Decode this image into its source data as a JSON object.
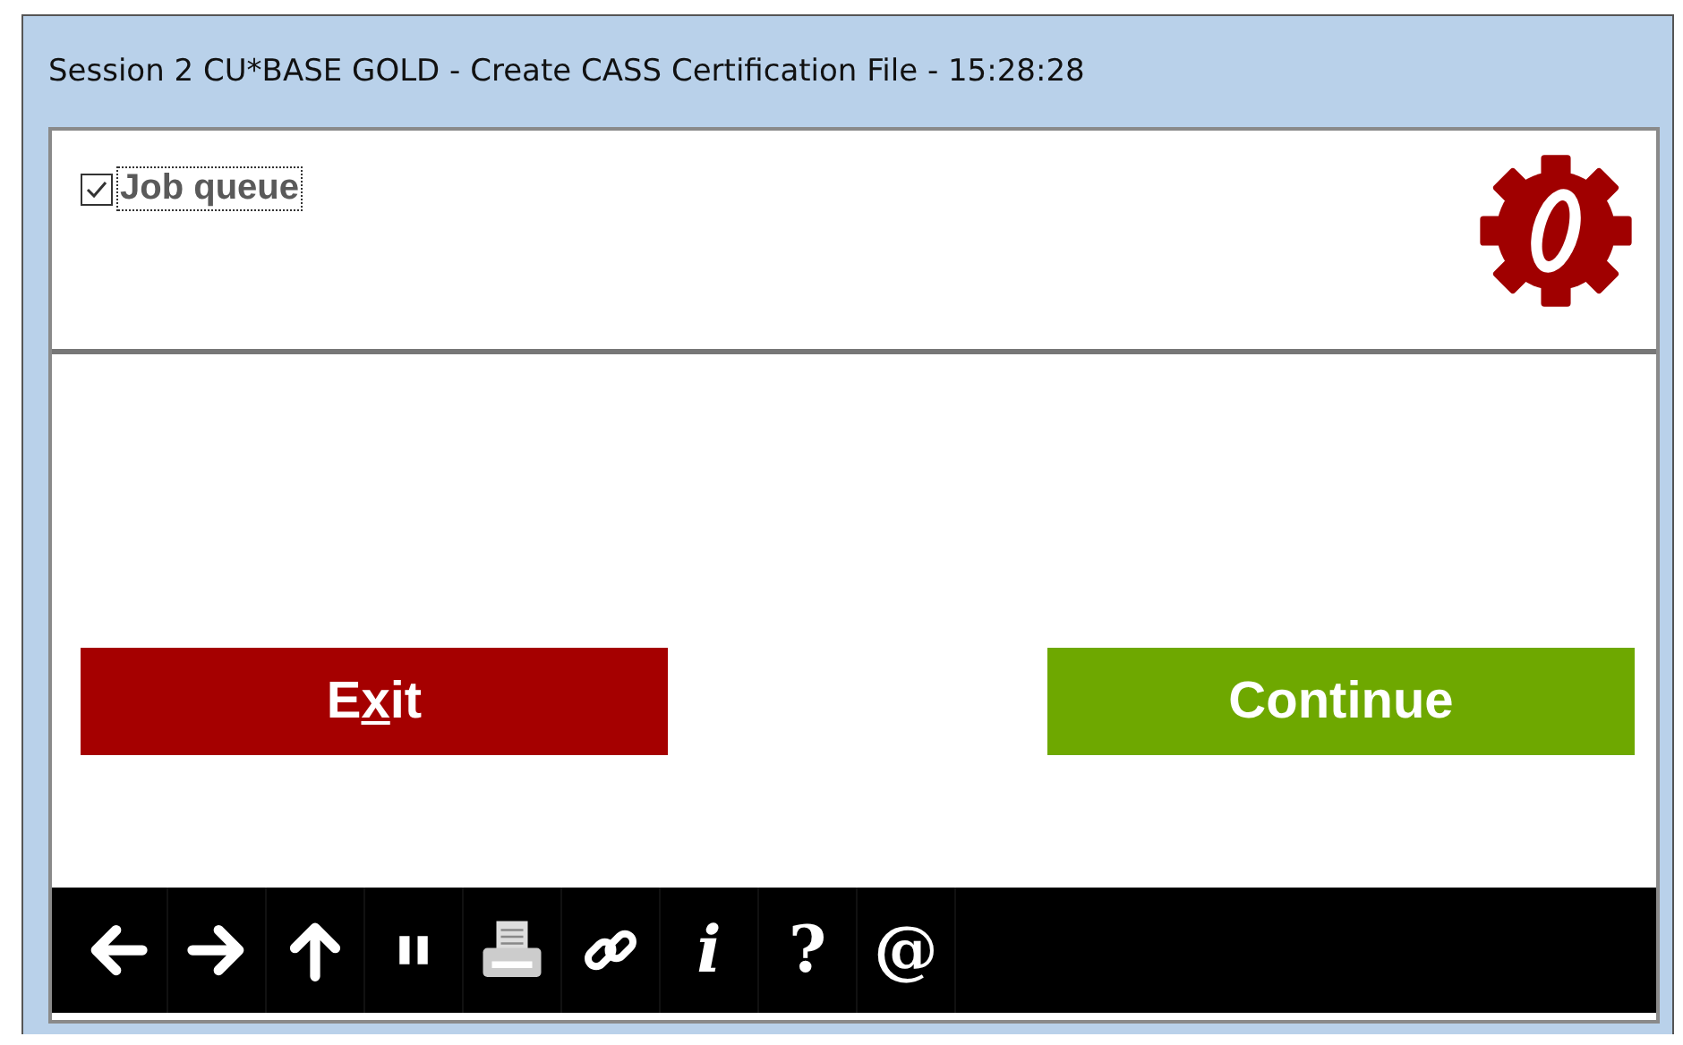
{
  "window": {
    "title": "Session 2 CU*BASE GOLD - Create CASS Certification File - 15:28:28"
  },
  "job_queue": {
    "label": "Job queue",
    "checked": true
  },
  "buttons": [
    {
      "kind": "exit",
      "label_parts": [
        {
          "text": "E",
          "underlined": false
        },
        {
          "text": "x",
          "underlined": true
        },
        {
          "text": "it",
          "underlined": false
        }
      ]
    },
    {
      "kind": "continue",
      "label": "Continue"
    }
  ],
  "toolbar": [
    {
      "kind": "back"
    },
    {
      "kind": "forward"
    },
    {
      "kind": "up"
    },
    {
      "kind": "pause"
    },
    {
      "kind": "print"
    },
    {
      "kind": "link"
    },
    {
      "kind": "glyph",
      "text": "i"
    },
    {
      "kind": "glyph",
      "text": "?"
    },
    {
      "kind": "glyph",
      "text": "@"
    }
  ]
}
